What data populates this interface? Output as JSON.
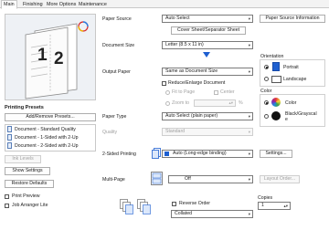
{
  "tabs": [
    "Main",
    "Finishing",
    "More Options",
    "Maintenance"
  ],
  "left": {
    "presets_title": "Printing Presets",
    "add_remove_label": "Add/Remove Presets...",
    "presets": [
      "Document - Standard Quality",
      "Document - 1-Sided with 2-Up",
      "Document - 2-Sided with 2-Up"
    ],
    "ink_levels_label": "Ink Levels",
    "show_settings_label": "Show Settings",
    "restore_defaults_label": "Restore Defaults",
    "print_preview_label": "Print Preview",
    "job_arranger_label": "Job Arranger Lite",
    "preview_pages": [
      "1",
      "2"
    ]
  },
  "main": {
    "paper_source_label": "Paper Source",
    "paper_source_value": "Auto Select",
    "paper_source_info_label": "Paper Source Information",
    "cover_sheet_label": "Cover Sheet/Separator Sheet",
    "document_size_label": "Document Size",
    "document_size_value": "Letter (8.5 x 11 in)",
    "output_paper_label": "Output Paper",
    "output_paper_value": "Same as Document Size",
    "reduce_enlarge_label": "Reduce/Enlarge Document",
    "fit_to_page_label": "Fit to Page",
    "center_label": "Center",
    "zoom_to_label": "Zoom to",
    "zoom_unit": "%",
    "paper_type_label": "Paper Type",
    "paper_type_value": "Auto Select (plain paper)",
    "quality_label": "Quality",
    "quality_value": "Standard",
    "two_sided_label": "2-Sided Printing",
    "two_sided_value": "Auto (Long-edge binding)",
    "settings_label": "Settings...",
    "multi_page_label": "Multi-Page",
    "multi_page_value": "Off",
    "layout_order_label": "Layout Order...",
    "reverse_order_label": "Reverse Order",
    "collated_value": "Collated",
    "copies_label": "Copies",
    "copies_value": "1"
  },
  "orientation": {
    "title": "Orientation",
    "portrait_label": "Portrait",
    "landscape_label": "Landscape"
  },
  "color": {
    "title": "Color",
    "color_label": "Color",
    "bw_line1": "Black/Grayscal",
    "bw_line2": "e"
  },
  "icons": {
    "preset": "document-preset-icon",
    "duplex": "two-sided-icon",
    "multipage": "multi-page-icon",
    "collate": "collate-icon"
  },
  "colors": {
    "accent": "#1e5fd0",
    "selection": "#0b63ce"
  }
}
